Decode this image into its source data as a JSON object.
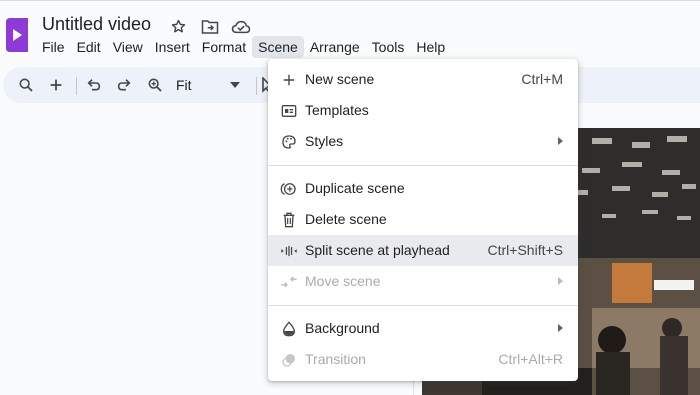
{
  "app": {
    "title": "Untitled video",
    "brand_color": "#7b2cbf"
  },
  "title_icons": [
    "star-icon",
    "move-to-folder-icon",
    "cloud-saved-icon"
  ],
  "menubar": {
    "items": [
      {
        "label": "File"
      },
      {
        "label": "Edit"
      },
      {
        "label": "View"
      },
      {
        "label": "Insert"
      },
      {
        "label": "Format"
      },
      {
        "label": "Scene",
        "active": true
      },
      {
        "label": "Arrange"
      },
      {
        "label": "Tools"
      },
      {
        "label": "Help"
      }
    ]
  },
  "toolbar": {
    "icons": [
      "search-icon",
      "add-icon",
      "undo-icon",
      "redo-icon",
      "zoom-icon"
    ],
    "zoom_label": "Fit"
  },
  "scene_menu": {
    "items": [
      {
        "label": "New scene",
        "shortcut": "Ctrl+M",
        "icon": "plus-icon"
      },
      {
        "label": "Templates",
        "shortcut": "",
        "icon": "templates-icon"
      },
      {
        "label": "Styles",
        "shortcut": "",
        "icon": "palette-icon",
        "submenu": true
      },
      {
        "label": "Duplicate scene",
        "shortcut": "",
        "icon": "duplicate-icon"
      },
      {
        "label": "Delete scene",
        "shortcut": "",
        "icon": "trash-icon"
      },
      {
        "label": "Split scene at playhead",
        "shortcut": "Ctrl+Shift+S",
        "icon": "split-icon",
        "highlighted": true
      },
      {
        "label": "Move scene",
        "shortcut": "",
        "icon": "move-icon",
        "submenu": true,
        "disabled": true
      },
      {
        "label": "Background",
        "shortcut": "",
        "icon": "background-fill-icon",
        "submenu": true
      },
      {
        "label": "Transition",
        "shortcut": "Ctrl+Alt+R",
        "icon": "transition-icon",
        "disabled": true
      }
    ]
  }
}
